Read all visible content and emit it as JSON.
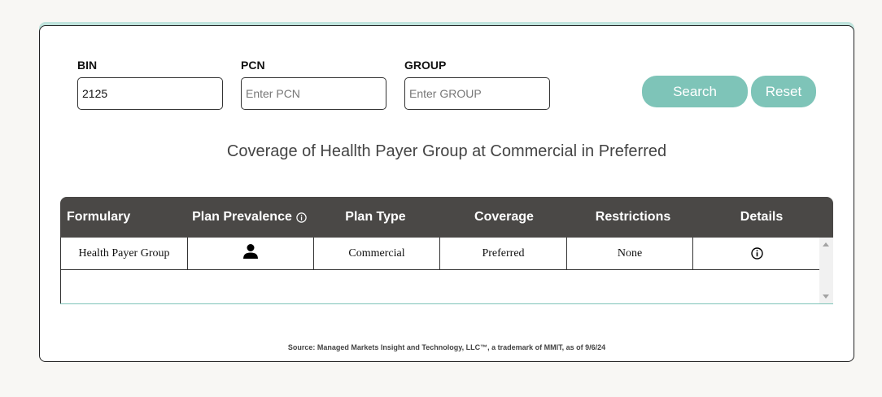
{
  "form": {
    "bin": {
      "label": "BIN",
      "value": "2125",
      "placeholder": ""
    },
    "pcn": {
      "label": "PCN",
      "value": "",
      "placeholder": "Enter PCN"
    },
    "group": {
      "label": "GROUP",
      "value": "",
      "placeholder": "Enter GROUP"
    },
    "search_label": "Search",
    "reset_label": "Reset"
  },
  "title": "Coverage of Heallth Payer Group at Commercial in Preferred",
  "table": {
    "headers": [
      "Formulary",
      "Plan Prevalence",
      "Plan Type",
      "Coverage",
      "Restrictions",
      "Details"
    ],
    "rows": [
      {
        "formulary": "Health Payer Group",
        "plan_prevalence_icon": "person-icon",
        "plan_type": "Commercial",
        "coverage": "Preferred",
        "restrictions": "None",
        "details_icon": "info-icon"
      }
    ]
  },
  "footer": "Source: Managed Markets Insight and Technology, LLC™, a trademark of MMIT, as of 9/6/24",
  "colors": {
    "accent": "#7ec4b8",
    "header_bg": "#4a4846",
    "page_bg": "#f8f7f4"
  }
}
